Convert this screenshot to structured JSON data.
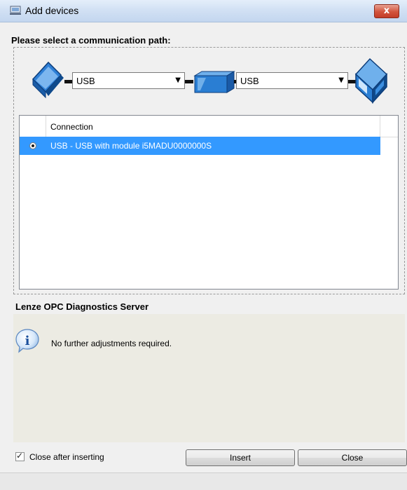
{
  "window": {
    "title": "Add devices",
    "close_glyph": "x"
  },
  "path": {
    "label": "Please select a communication path:",
    "combo1": {
      "value": "USB"
    },
    "combo2": {
      "value": "USB"
    }
  },
  "table": {
    "header": "Connection",
    "rows": [
      {
        "selected": true,
        "text": "USB - USB with module i5MADU0000000S"
      }
    ]
  },
  "server": {
    "label": "Lenze OPC Diagnostics Server",
    "message": "No further adjustments required."
  },
  "footer": {
    "checkbox_label": "Close after inserting",
    "checkbox_checked": true,
    "insert_label": "Insert",
    "close_label": "Close"
  },
  "colors": {
    "selection": "#3399ff",
    "device_blue": "#2a7ed3"
  }
}
